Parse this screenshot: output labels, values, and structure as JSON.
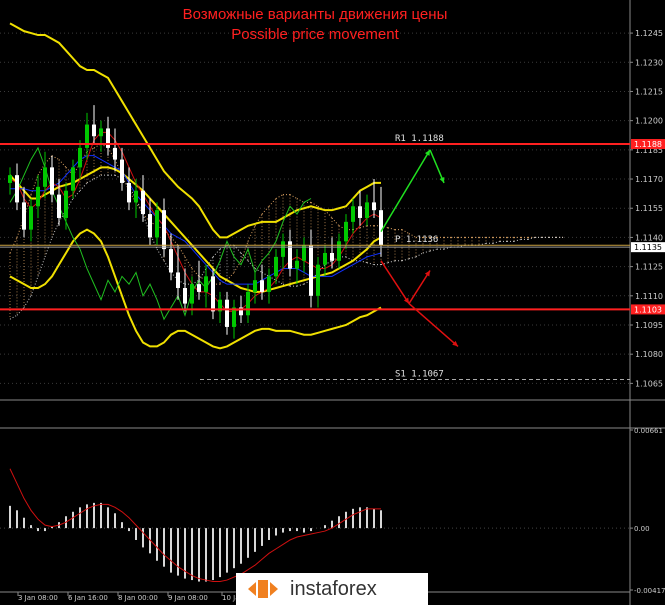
{
  "header": {
    "title_ru": "Возможные варианты движения цены",
    "title_en": "Possible price movement"
  },
  "logo": {
    "text": "instaforex"
  },
  "colors": {
    "background": "#000000",
    "grid": "#3a3a3a",
    "bull_candle": "#00c800",
    "bear_candle": "#ffffff",
    "bollinger": "#f0e000",
    "tenkan": "#d01010",
    "kijun": "#1030ff",
    "chikou": "#20c020",
    "level_line": "#ff2020",
    "pivot_line": "#c8a040",
    "arrow_up": "#20e020",
    "arrow_down": "#e01010",
    "osc_bar": "#d8d8d8",
    "osc_signal": "#d01010"
  },
  "chart_data": {
    "type": "candlestick",
    "symbol": "EURUSD",
    "ylim": [
      1.1058,
      1.1262
    ],
    "y_ticks": [
      1.1245,
      1.123,
      1.1215,
      1.12,
      1.1185,
      1.117,
      1.1155,
      1.114,
      1.1125,
      1.111,
      1.1095,
      1.108,
      1.1065
    ],
    "x_tick_labels": [
      "3 Jan 08:00",
      "6 Jan 16:00",
      "8 Jan 00:00",
      "9 Jan 08:00",
      "10 Jan"
    ],
    "current_price": 1.1135,
    "current_price_label": "1.1135",
    "levels": [
      {
        "name": "R1",
        "label": "R1  1.1188",
        "value": 1.1188,
        "axis_label": "1.1188",
        "style": "red-thick"
      },
      {
        "name": "P",
        "label": "P  1.1136",
        "value": 1.1136,
        "style": "pivot"
      },
      {
        "name": "S",
        "value": 1.1103,
        "axis_label": "1.1103",
        "style": "red-thick"
      },
      {
        "name": "S1",
        "label": "S1  1.1067",
        "value": 1.1067,
        "style": "dashed"
      }
    ],
    "candles": [
      [
        1.1168,
        1.1176,
        1.1162,
        1.1172
      ],
      [
        1.1172,
        1.1178,
        1.1154,
        1.1158
      ],
      [
        1.1158,
        1.1166,
        1.114,
        1.1144
      ],
      [
        1.1144,
        1.116,
        1.1138,
        1.1156
      ],
      [
        1.1156,
        1.1172,
        1.115,
        1.1166
      ],
      [
        1.1166,
        1.1184,
        1.116,
        1.1176
      ],
      [
        1.1176,
        1.1182,
        1.1158,
        1.1162
      ],
      [
        1.1162,
        1.117,
        1.1146,
        1.115
      ],
      [
        1.115,
        1.1168,
        1.1144,
        1.1164
      ],
      [
        1.1164,
        1.118,
        1.116,
        1.1176
      ],
      [
        1.1176,
        1.119,
        1.117,
        1.1186
      ],
      [
        1.1186,
        1.1204,
        1.118,
        1.1198
      ],
      [
        1.1198,
        1.1208,
        1.1188,
        1.1192
      ],
      [
        1.1192,
        1.12,
        1.1184,
        1.1196
      ],
      [
        1.1196,
        1.1202,
        1.1182,
        1.1186
      ],
      [
        1.1186,
        1.1196,
        1.1174,
        1.118
      ],
      [
        1.118,
        1.1186,
        1.1164,
        1.1168
      ],
      [
        1.1168,
        1.1176,
        1.1154,
        1.1158
      ],
      [
        1.1158,
        1.117,
        1.115,
        1.1164
      ],
      [
        1.1164,
        1.1172,
        1.1148,
        1.1152
      ],
      [
        1.1152,
        1.116,
        1.1136,
        1.114
      ],
      [
        1.114,
        1.1158,
        1.1136,
        1.1154
      ],
      [
        1.1154,
        1.116,
        1.113,
        1.1134
      ],
      [
        1.1134,
        1.1142,
        1.1118,
        1.1122
      ],
      [
        1.1122,
        1.1136,
        1.1108,
        1.1114
      ],
      [
        1.1114,
        1.1124,
        1.1102,
        1.1106
      ],
      [
        1.1106,
        1.112,
        1.11,
        1.1116
      ],
      [
        1.1116,
        1.1128,
        1.1108,
        1.1112
      ],
      [
        1.1112,
        1.1126,
        1.1104,
        1.112
      ],
      [
        1.112,
        1.1124,
        1.1098,
        1.1102
      ],
      [
        1.1102,
        1.1112,
        1.1096,
        1.1108
      ],
      [
        1.1108,
        1.1112,
        1.109,
        1.1094
      ],
      [
        1.1094,
        1.1108,
        1.1088,
        1.1104
      ],
      [
        1.1104,
        1.111,
        1.1096,
        1.11
      ],
      [
        1.11,
        1.1116,
        1.1096,
        1.1112
      ],
      [
        1.1112,
        1.1122,
        1.1106,
        1.1118
      ],
      [
        1.1118,
        1.1126,
        1.1108,
        1.1112
      ],
      [
        1.1112,
        1.1124,
        1.1106,
        1.112
      ],
      [
        1.112,
        1.1134,
        1.1116,
        1.113
      ],
      [
        1.113,
        1.1142,
        1.1124,
        1.1138
      ],
      [
        1.1138,
        1.1144,
        1.112,
        1.1124
      ],
      [
        1.1124,
        1.1134,
        1.1116,
        1.1128
      ],
      [
        1.1128,
        1.114,
        1.1122,
        1.1136
      ],
      [
        1.1136,
        1.1144,
        1.1104,
        1.111
      ],
      [
        1.111,
        1.113,
        1.1104,
        1.1126
      ],
      [
        1.1126,
        1.1136,
        1.112,
        1.1132
      ],
      [
        1.1132,
        1.114,
        1.1124,
        1.1128
      ],
      [
        1.1128,
        1.1142,
        1.1124,
        1.1138
      ],
      [
        1.1138,
        1.1152,
        1.1134,
        1.1148
      ],
      [
        1.1148,
        1.116,
        1.1142,
        1.1156
      ],
      [
        1.1156,
        1.1164,
        1.1146,
        1.115
      ],
      [
        1.115,
        1.1162,
        1.1146,
        1.1158
      ],
      [
        1.1158,
        1.117,
        1.115,
        1.1154
      ],
      [
        1.1154,
        1.1166,
        1.113,
        1.1136
      ]
    ],
    "bollinger_upper": [
      1.125,
      1.1248,
      1.1246,
      1.1245,
      1.1244,
      1.1244,
      1.1242,
      1.124,
      1.1236,
      1.1232,
      1.1228,
      1.1226,
      1.1226,
      1.1224,
      1.1222,
      1.1216,
      1.121,
      1.1204,
      1.1198,
      1.1192,
      1.1186,
      1.118,
      1.1174,
      1.117,
      1.1166,
      1.1163,
      1.116,
      1.1156,
      1.115,
      1.1144,
      1.114,
      1.114,
      1.1142,
      1.1144,
      1.1146,
      1.1147,
      1.1148,
      1.1148,
      1.1148,
      1.115,
      1.1152,
      1.1154,
      1.1155,
      1.1156,
      1.1155,
      1.1154,
      1.1154,
      1.1155,
      1.1156,
      1.116,
      1.1164,
      1.1166,
      1.1168,
      1.1168
    ],
    "bollinger_middle": [
      1.1172,
      1.1168,
      1.1164,
      1.116,
      1.116,
      1.1162,
      1.1164,
      1.1166,
      1.1167,
      1.1168,
      1.117,
      1.1172,
      1.1174,
      1.1176,
      1.1176,
      1.1175,
      1.1173,
      1.117,
      1.1167,
      1.1164,
      1.116,
      1.1156,
      1.1152,
      1.1148,
      1.1144,
      1.114,
      1.1136,
      1.1132,
      1.1128,
      1.1124,
      1.112,
      1.1118,
      1.1116,
      1.1114,
      1.1113,
      1.1112,
      1.1112,
      1.1113,
      1.1114,
      1.1115,
      1.1116,
      1.1117,
      1.1118,
      1.1119,
      1.112,
      1.1121,
      1.1122,
      1.1124,
      1.1126,
      1.1128,
      1.1131,
      1.1134,
      1.1138,
      1.114
    ],
    "bollinger_lower": [
      1.112,
      1.1118,
      1.1116,
      1.1114,
      1.1114,
      1.1116,
      1.112,
      1.1126,
      1.1132,
      1.1138,
      1.1142,
      1.1144,
      1.1142,
      1.1138,
      1.113,
      1.112,
      1.111,
      1.11,
      1.1092,
      1.1086,
      1.1084,
      1.1084,
      1.1086,
      1.109,
      1.1092,
      1.1092,
      1.109,
      1.1088,
      1.1086,
      1.1084,
      1.1083,
      1.1084,
      1.1086,
      1.1088,
      1.109,
      1.1092,
      1.1093,
      1.1093,
      1.1092,
      1.1092,
      1.1092,
      1.1091,
      1.109,
      1.109,
      1.1091,
      1.1092,
      1.1093,
      1.1094,
      1.1095,
      1.1097,
      1.1099,
      1.11,
      1.1102,
      1.1104
    ],
    "tenkan": [
      1.117,
      1.1168,
      1.116,
      1.1155,
      1.1158,
      1.1164,
      1.1168,
      1.1166,
      1.116,
      1.1162,
      1.117,
      1.118,
      1.119,
      1.1194,
      1.1194,
      1.119,
      1.1184,
      1.1176,
      1.1168,
      1.1162,
      1.1156,
      1.115,
      1.1146,
      1.1138,
      1.113,
      1.1122,
      1.1116,
      1.1112,
      1.1112,
      1.111,
      1.1106,
      1.1102,
      1.1102,
      1.1103,
      1.1106,
      1.111,
      1.1112,
      1.1114,
      1.1118,
      1.1124,
      1.1128,
      1.113,
      1.1128,
      1.1126,
      1.1124,
      1.1124,
      1.1126,
      1.113,
      1.1136,
      1.1142,
      1.1146,
      1.115,
      1.1152,
      1.115
    ],
    "kijun": [
      1.1165,
      1.1165,
      1.1165,
      1.1164,
      1.1164,
      1.1164,
      1.1166,
      1.1168,
      1.1172,
      1.1176,
      1.118,
      1.1182,
      1.1182,
      1.118,
      1.1178,
      1.1176,
      1.1174,
      1.1168,
      1.1162,
      1.1158,
      1.1154,
      1.115,
      1.1146,
      1.1142,
      1.114,
      1.1138,
      1.1134,
      1.113,
      1.1126,
      1.1122,
      1.1118,
      1.1116,
      1.1116,
      1.1116,
      1.1116,
      1.1116,
      1.1118,
      1.112,
      1.1122,
      1.1124,
      1.1124,
      1.1124,
      1.1122,
      1.112,
      1.112,
      1.112,
      1.112,
      1.1122,
      1.1124,
      1.1126,
      1.1128,
      1.113,
      1.1131,
      1.1132
    ],
    "chikou": [
      1.1158,
      1.1164,
      1.1172,
      1.118,
      1.1186,
      1.1176,
      1.1164,
      1.1156,
      1.1148,
      1.114,
      1.1134,
      1.1124,
      1.1116,
      1.1108,
      1.1118,
      1.1112,
      1.112,
      1.1116,
      1.1122,
      1.111,
      1.1116,
      1.1108,
      1.1098,
      1.1104,
      1.111,
      1.11,
      1.1112,
      1.1118,
      1.1114,
      1.112,
      1.1128,
      1.1138,
      1.113,
      1.1126,
      1.1134,
      1.1122,
      1.1128,
      1.1132,
      1.1138,
      1.1148,
      1.1156,
      1.1152,
      1.1158,
      1.116
    ],
    "cloud_span_a": [
      1.1132,
      1.114,
      1.115,
      1.1162,
      1.1172,
      1.1178,
      1.1182,
      1.118,
      1.1176,
      1.1172,
      1.1178,
      1.1184,
      1.1186,
      1.1188,
      1.1186,
      1.118,
      1.1172,
      1.1164,
      1.1158,
      1.1152,
      1.1148,
      1.1146,
      1.1144,
      1.114,
      1.1136,
      1.113,
      1.1124,
      1.112,
      1.1118,
      1.1116,
      1.1116,
      1.1118,
      1.1122,
      1.1128,
      1.1138,
      1.1146,
      1.1152,
      1.1156,
      1.116,
      1.1162,
      1.1162,
      1.116,
      1.1158,
      1.1158,
      1.1156,
      1.1154,
      1.115,
      1.1146,
      1.1144,
      1.1144,
      1.1145,
      1.1146,
      1.1146,
      1.1146,
      1.1145,
      1.1144,
      1.1144,
      1.1142,
      1.114,
      1.114,
      1.114,
      1.114,
      1.114,
      1.114,
      1.114,
      1.114,
      1.114,
      1.114,
      1.114,
      1.114,
      1.114,
      1.114,
      1.114,
      1.114,
      1.114,
      1.114,
      1.114,
      1.114,
      1.114,
      1.114
    ],
    "cloud_span_b": [
      1.1098,
      1.11,
      1.1104,
      1.111,
      1.112,
      1.113,
      1.114,
      1.1148,
      1.1154,
      1.116,
      1.1164,
      1.1168,
      1.117,
      1.1172,
      1.1172,
      1.1172,
      1.117,
      1.1166,
      1.116,
      1.1152,
      1.1142,
      1.1134,
      1.1128,
      1.1122,
      1.1118,
      1.1116,
      1.1116,
      1.1118,
      1.1124,
      1.113,
      1.1134,
      1.1136,
      1.1136,
      1.1132,
      1.1128,
      1.1124,
      1.1122,
      1.112,
      1.1118,
      1.1116,
      1.1115,
      1.1115,
      1.1116,
      1.1118,
      1.1122,
      1.1126,
      1.1128,
      1.113,
      1.113,
      1.1128,
      1.1128,
      1.1127,
      1.1126,
      1.1126,
      1.1127,
      1.1128,
      1.1128,
      1.1129,
      1.113,
      1.1132,
      1.1133,
      1.1134,
      1.1134,
      1.1135,
      1.1135,
      1.1136,
      1.1136,
      1.1136,
      1.1137,
      1.1137,
      1.1138,
      1.1138,
      1.1138,
      1.1139,
      1.1139,
      1.114,
      1.114,
      1.114,
      1.114,
      1.114
    ],
    "oscillator": {
      "ylim": [
        -0.00417,
        0.00661
      ],
      "y_ticks": [
        0.00661,
        0.0,
        -0.00417
      ],
      "y_tick_labels": [
        "0.00661",
        "0.00",
        "-0.00417"
      ],
      "bars": [
        0.0015,
        0.0012,
        0.0007,
        0.0002,
        -0.0002,
        -0.0002,
        0.0001,
        0.0004,
        0.0008,
        0.0011,
        0.0014,
        0.0016,
        0.0017,
        0.0017,
        0.0014,
        0.001,
        0.0004,
        -0.0002,
        -0.0008,
        -0.0013,
        -0.0017,
        -0.0022,
        -0.0026,
        -0.003,
        -0.0032,
        -0.0034,
        -0.0035,
        -0.0036,
        -0.0036,
        -0.0035,
        -0.0033,
        -0.003,
        -0.0027,
        -0.0024,
        -0.002,
        -0.0016,
        -0.0012,
        -0.0008,
        -0.0005,
        -0.0003,
        -0.0002,
        -0.0002,
        -0.0003,
        -0.0002,
        0.0,
        0.0002,
        0.0005,
        0.0008,
        0.0011,
        0.0013,
        0.0014,
        0.0014,
        0.0013,
        0.0012
      ],
      "signal": [
        0.004,
        0.003,
        0.002,
        0.0012,
        0.0006,
        0.0002,
        0.0001,
        0.0002,
        0.0004,
        0.0007,
        0.001,
        0.0013,
        0.0015,
        0.0016,
        0.0016,
        0.0014,
        0.0011,
        0.0007,
        0.0002,
        -0.0003,
        -0.0008,
        -0.0013,
        -0.0018,
        -0.0022,
        -0.0026,
        -0.0029,
        -0.0032,
        -0.0034,
        -0.0035,
        -0.0036,
        -0.0036,
        -0.0035,
        -0.0033,
        -0.0031,
        -0.0028,
        -0.0025,
        -0.0021,
        -0.0017,
        -0.0014,
        -0.0011,
        -0.0008,
        -0.0006,
        -0.0005,
        -0.0004,
        -0.0003,
        -0.0002,
        0.0,
        0.0003,
        0.0006,
        0.0009,
        0.0011,
        0.0013,
        0.0013,
        0.0013
      ]
    },
    "arrows": [
      {
        "direction": "up",
        "from_index": 53,
        "from_value": 1.1143,
        "to_index": 60,
        "to_value": 1.1185
      },
      {
        "direction": "up-small",
        "from_index": 60,
        "from_value": 1.1185,
        "to_index": 62,
        "to_value": 1.1168
      },
      {
        "direction": "down",
        "from_index": 53,
        "from_value": 1.1128,
        "to_index": 57,
        "to_value": 1.1106
      },
      {
        "direction": "up-small",
        "from_index": 57,
        "from_value": 1.1106,
        "to_index": 60,
        "to_value": 1.1123
      },
      {
        "direction": "down",
        "from_index": 57,
        "from_value": 1.1106,
        "to_index": 64,
        "to_value": 1.1084
      }
    ]
  }
}
